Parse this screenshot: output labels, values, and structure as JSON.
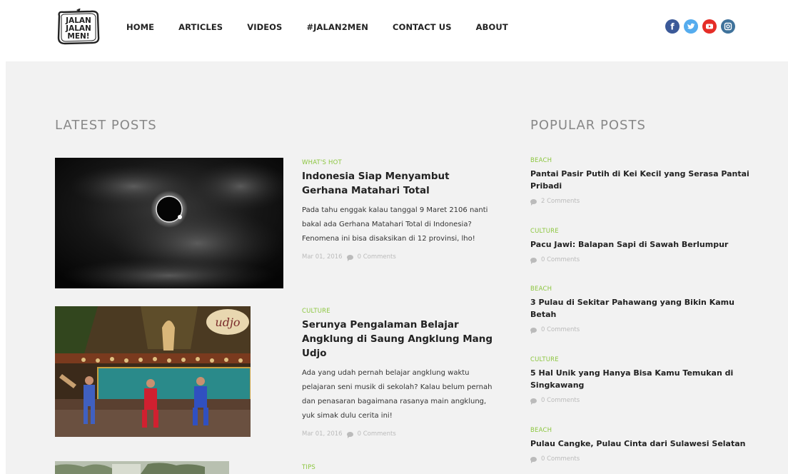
{
  "logo": {
    "lines": [
      "JALAN",
      "JALAN",
      "MEN!"
    ]
  },
  "nav": {
    "items": [
      "HOME",
      "ARTICLES",
      "VIDEOS",
      "#JALAN2MEN",
      "CONTACT US",
      "ABOUT"
    ]
  },
  "social": [
    {
      "name": "facebook-icon",
      "glyph": "f",
      "color": "#3b5998"
    },
    {
      "name": "twitter-icon",
      "glyph": "t",
      "color": "#55acee"
    },
    {
      "name": "youtube-icon",
      "glyph": "▶",
      "color": "#e52d27"
    },
    {
      "name": "instagram-icon",
      "glyph": "◙",
      "color": "#3f729b"
    }
  ],
  "latest": {
    "title": "LATEST POSTS",
    "posts": [
      {
        "category": "WHAT'S HOT",
        "title": "Indonesia Siap Menyambut Gerhana Matahari Total",
        "excerpt": "Pada tahu enggak kalau tanggal 9 Maret 2106 nanti bakal ada Gerhana Matahari Total di Indonesia? Fenomena ini bisa disaksikan di 12 provinsi, lho!",
        "date": "Mar 01, 2016",
        "comments": "0 Comments"
      },
      {
        "category": "CULTURE",
        "title": "Serunya Pengalaman Belajar Angklung di Saung Angklung Mang Udjo",
        "excerpt": "Ada yang udah pernah belajar angklung waktu pelajaran seni musik di sekolah? Kalau belum pernah dan penasaran bagaimana rasanya main angklung, yuk simak dulu cerita ini!",
        "date": "Mar 01, 2016",
        "comments": "0 Comments"
      },
      {
        "category": "TIPS"
      }
    ]
  },
  "popular": {
    "title": "POPULAR POSTS",
    "posts": [
      {
        "category": "BEACH",
        "title": "Pantai Pasir Putih di Kei Kecil yang Serasa Pantai Pribadi",
        "comments": "2 Comments"
      },
      {
        "category": "CULTURE",
        "title": "Pacu Jawi: Balapan Sapi di Sawah Berlumpur",
        "comments": "0 Comments"
      },
      {
        "category": "BEACH",
        "title": "3 Pulau di Sekitar Pahawang yang Bikin Kamu Betah",
        "comments": "0 Comments"
      },
      {
        "category": "CULTURE",
        "title": "5 Hal Unik yang Hanya Bisa Kamu Temukan di Singkawang",
        "comments": "0 Comments"
      },
      {
        "category": "BEACH",
        "title": "Pulau Cangke, Pulau Cinta dari Sulawesi Selatan",
        "comments": "0 Comments"
      }
    ]
  }
}
